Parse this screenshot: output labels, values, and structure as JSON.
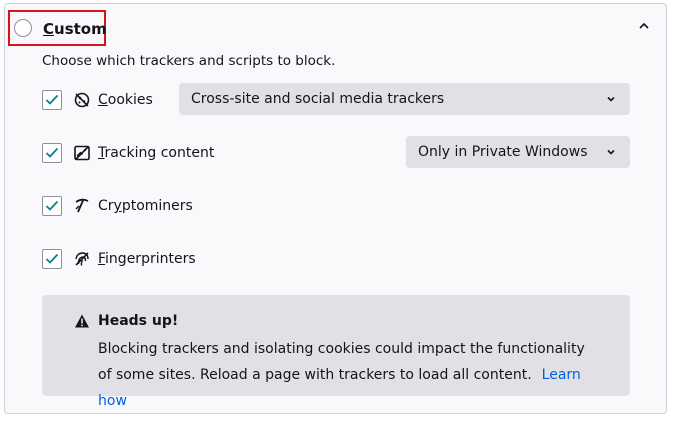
{
  "section": {
    "title_accesskey": "C",
    "title_rest": "ustom",
    "description": "Choose which trackers and scripts to block."
  },
  "options": {
    "cookies": {
      "checked": true,
      "accesskey": "C",
      "label_rest": "ookies",
      "select_value": "Cross-site and social media trackers"
    },
    "tracking": {
      "checked": true,
      "accesskey": "T",
      "label_rest": "racking content",
      "select_value": "Only in Private Windows"
    },
    "cryptominers": {
      "checked": true,
      "accesskey": "y",
      "label_pre": "Cr",
      "label_rest": "ptominers"
    },
    "fingerprinters": {
      "checked": true,
      "accesskey": "F",
      "label_rest": "ingerprinters"
    }
  },
  "warning": {
    "title": "Heads up!",
    "body": "Blocking trackers and isolating cookies could impact the functionality of some sites. Reload a page with trackers to load all content.",
    "link": "Learn how"
  },
  "colors": {
    "check": "#0c7d8f",
    "highlight_border": "#d7141a",
    "link": "#0061e0"
  }
}
